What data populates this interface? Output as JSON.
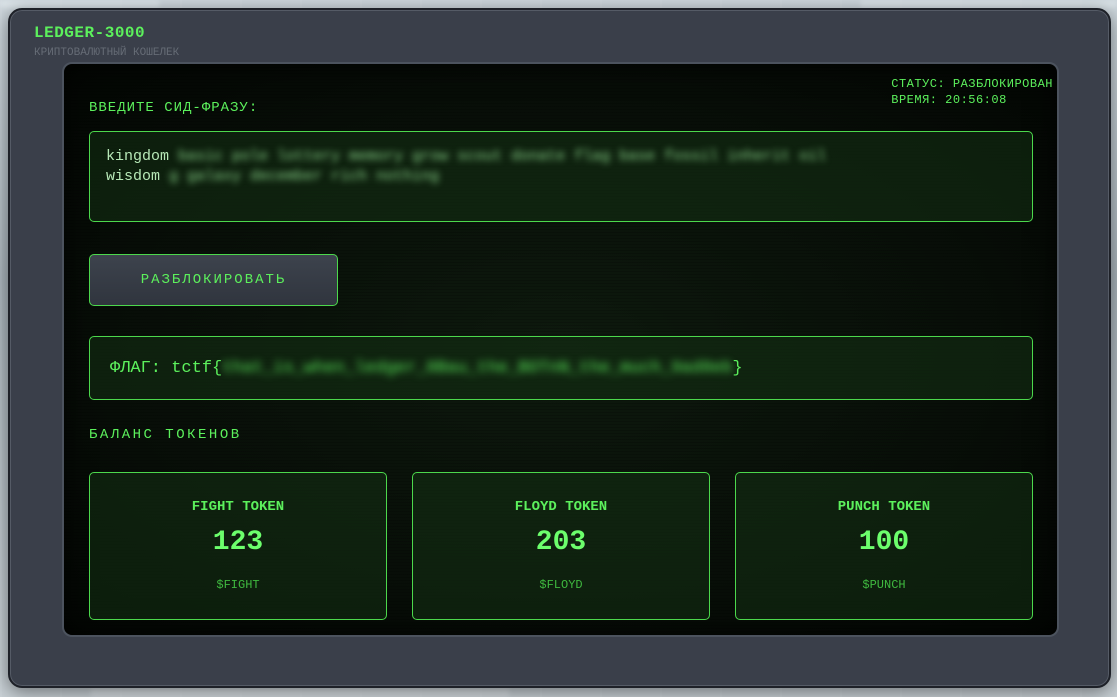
{
  "app": {
    "title": "LEDGER-3000",
    "subtitle": "КРИПТОВАЛЮТНЫЙ КОШЕЛЕК"
  },
  "status": {
    "state": "СТАТУС: РАЗБЛОКИРОВАН",
    "time": "ВРЕМЯ: 20:56:08"
  },
  "seed": {
    "label": "ВВЕДИТЕ СИД-ФРАЗУ:",
    "line1_visible": "kingdom",
    "line1_hidden": "basic pole lottery memory grow scout donate flag base fossil inherit oil",
    "line2_visible": "wisdom",
    "line2_hidden": "g galaxy december rich nothing"
  },
  "unlock": {
    "label": "РАЗБЛОКИРОВАТЬ"
  },
  "flag": {
    "prefix": "ФЛАГ: tctf{",
    "hidden": "that_is_when_ledger_8Bau_the_BOTnN_the_much_9ad8eb",
    "suffix": "}"
  },
  "balance": {
    "title": "БАЛАНС ТОКЕНОВ",
    "tokens": [
      {
        "name": "FIGHT TOKEN",
        "amount": "123",
        "symbol": "$FIGHT"
      },
      {
        "name": "FLOYD TOKEN",
        "amount": "203",
        "symbol": "$FLOYD"
      },
      {
        "name": "PUNCH TOKEN",
        "amount": "100",
        "symbol": "$PUNCH"
      }
    ]
  },
  "colors": {
    "accent": "#5cf05c",
    "frame": "#3a3f4a",
    "screen": "#060b06"
  }
}
